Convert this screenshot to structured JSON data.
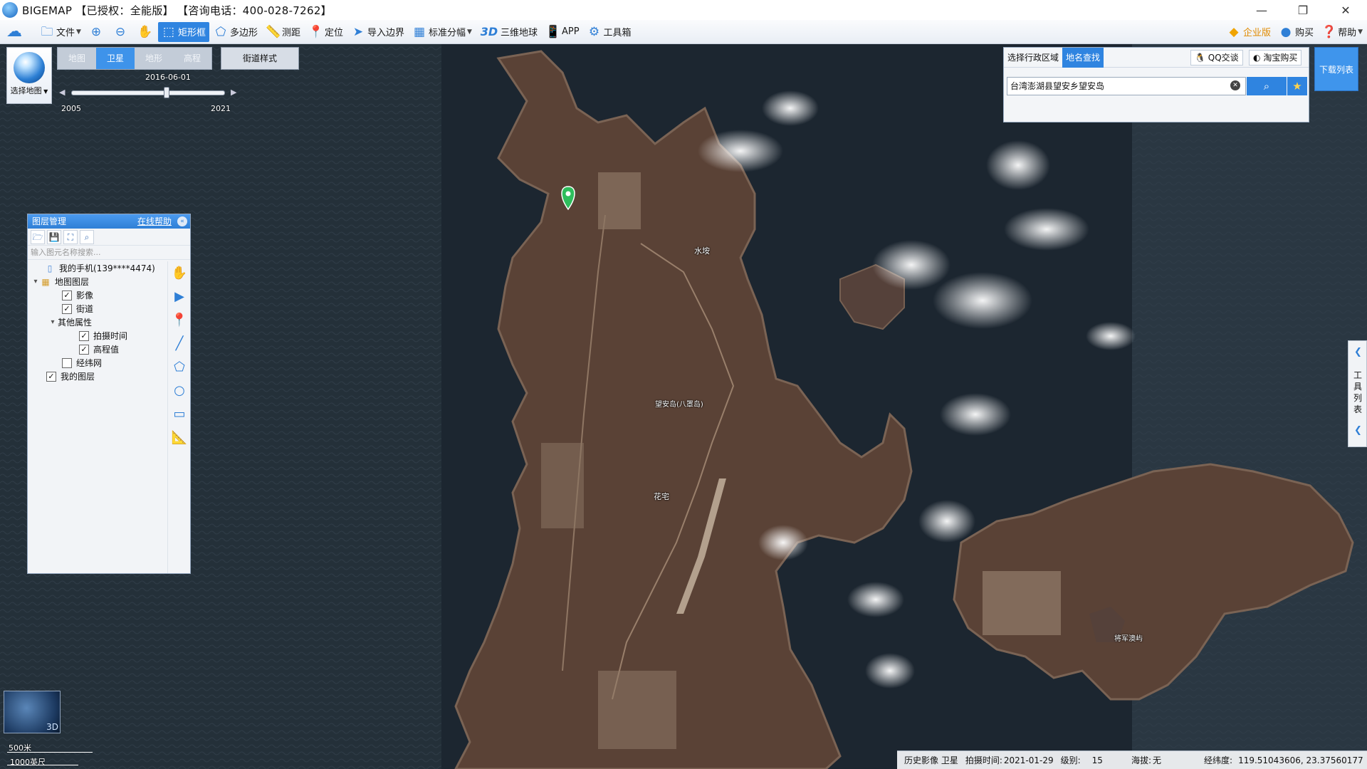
{
  "window": {
    "title": "BIGEMAP 【已授权：全能版】 【咨询电话：400-028-7262】",
    "minimize": "—",
    "restore": "❐",
    "close": "✕"
  },
  "toolbar": {
    "file": "文件",
    "zoom_in": "⊕",
    "zoom_out": "⊖",
    "pan": "✋",
    "rect": "矩形框",
    "polygon": "多边形",
    "measure": "测距",
    "locate": "定位",
    "import": "导入边界",
    "grid": "标准分幅",
    "earth3d_prefix": "3D",
    "earth3d": "三维地球",
    "app": "APP",
    "toolbox": "工具箱",
    "enterprise": "企业版",
    "buy": "购买",
    "help": "帮助"
  },
  "map_selector": {
    "label": "选择地图"
  },
  "map_types": [
    "地图",
    "卫星",
    "地形",
    "高程"
  ],
  "map_type_active": 1,
  "street_style": "街道样式",
  "timeline": {
    "date": "2016-06-01",
    "start_year": "2005",
    "end_year": "2021",
    "position": 0.62
  },
  "layers": {
    "title": "图层管理",
    "help": "在线帮助",
    "search_placeholder": "输入图元名称搜索...",
    "items": [
      {
        "label": "我的手机(139****4474)",
        "indent": 1,
        "checkbox": false,
        "toggle": "",
        "icon": "phone-icon",
        "checked": false
      },
      {
        "label": "地图图层",
        "indent": 0,
        "checkbox": false,
        "toggle": "▾",
        "icon": "folder-icon",
        "checked": false
      },
      {
        "label": "影像",
        "indent": 2,
        "checkbox": true,
        "toggle": "",
        "checked": true
      },
      {
        "label": "街道",
        "indent": 2,
        "checkbox": true,
        "toggle": "",
        "checked": true
      },
      {
        "label": "其他属性",
        "indent": 1,
        "checkbox": false,
        "toggle": "▾",
        "checked": false
      },
      {
        "label": "拍摄时间",
        "indent": 3,
        "checkbox": true,
        "toggle": "",
        "checked": true
      },
      {
        "label": "高程值",
        "indent": 3,
        "checkbox": true,
        "toggle": "",
        "checked": true
      },
      {
        "label": "经纬网",
        "indent": 2,
        "checkbox": true,
        "toggle": "",
        "checked": false
      },
      {
        "label": "我的图层",
        "indent": 0,
        "checkbox": true,
        "toggle": "",
        "checked": true
      }
    ]
  },
  "search_panel": {
    "tab_region": "选择行政区域",
    "tab_place": "地名查找",
    "qq": "QQ交谈",
    "taobao": "淘宝购买",
    "query": "台湾澎湖县望安乡望安岛"
  },
  "download_list": "下载列表",
  "tool_list": "工具列表",
  "map_labels": {
    "l1": "水垵",
    "l2": "望安岛(八罩岛)",
    "l3": "花宅",
    "l4": "将军澳屿"
  },
  "mini3d": "3D",
  "scale": {
    "metric": "500米",
    "imperial": "1000英尺"
  },
  "status": {
    "imagery": "历史影像 卫星",
    "capture_label": "拍摄时间:",
    "capture": "2021-01-29",
    "level_label": "级别:",
    "level": "15",
    "altitude_label": "海拔:",
    "altitude": "无",
    "coord_label": "经纬度:",
    "coord": "119.51043606, 23.37560177"
  },
  "colors": {
    "accent": "#2f84e0",
    "sea": "#24313d",
    "land": "#5a4236"
  }
}
